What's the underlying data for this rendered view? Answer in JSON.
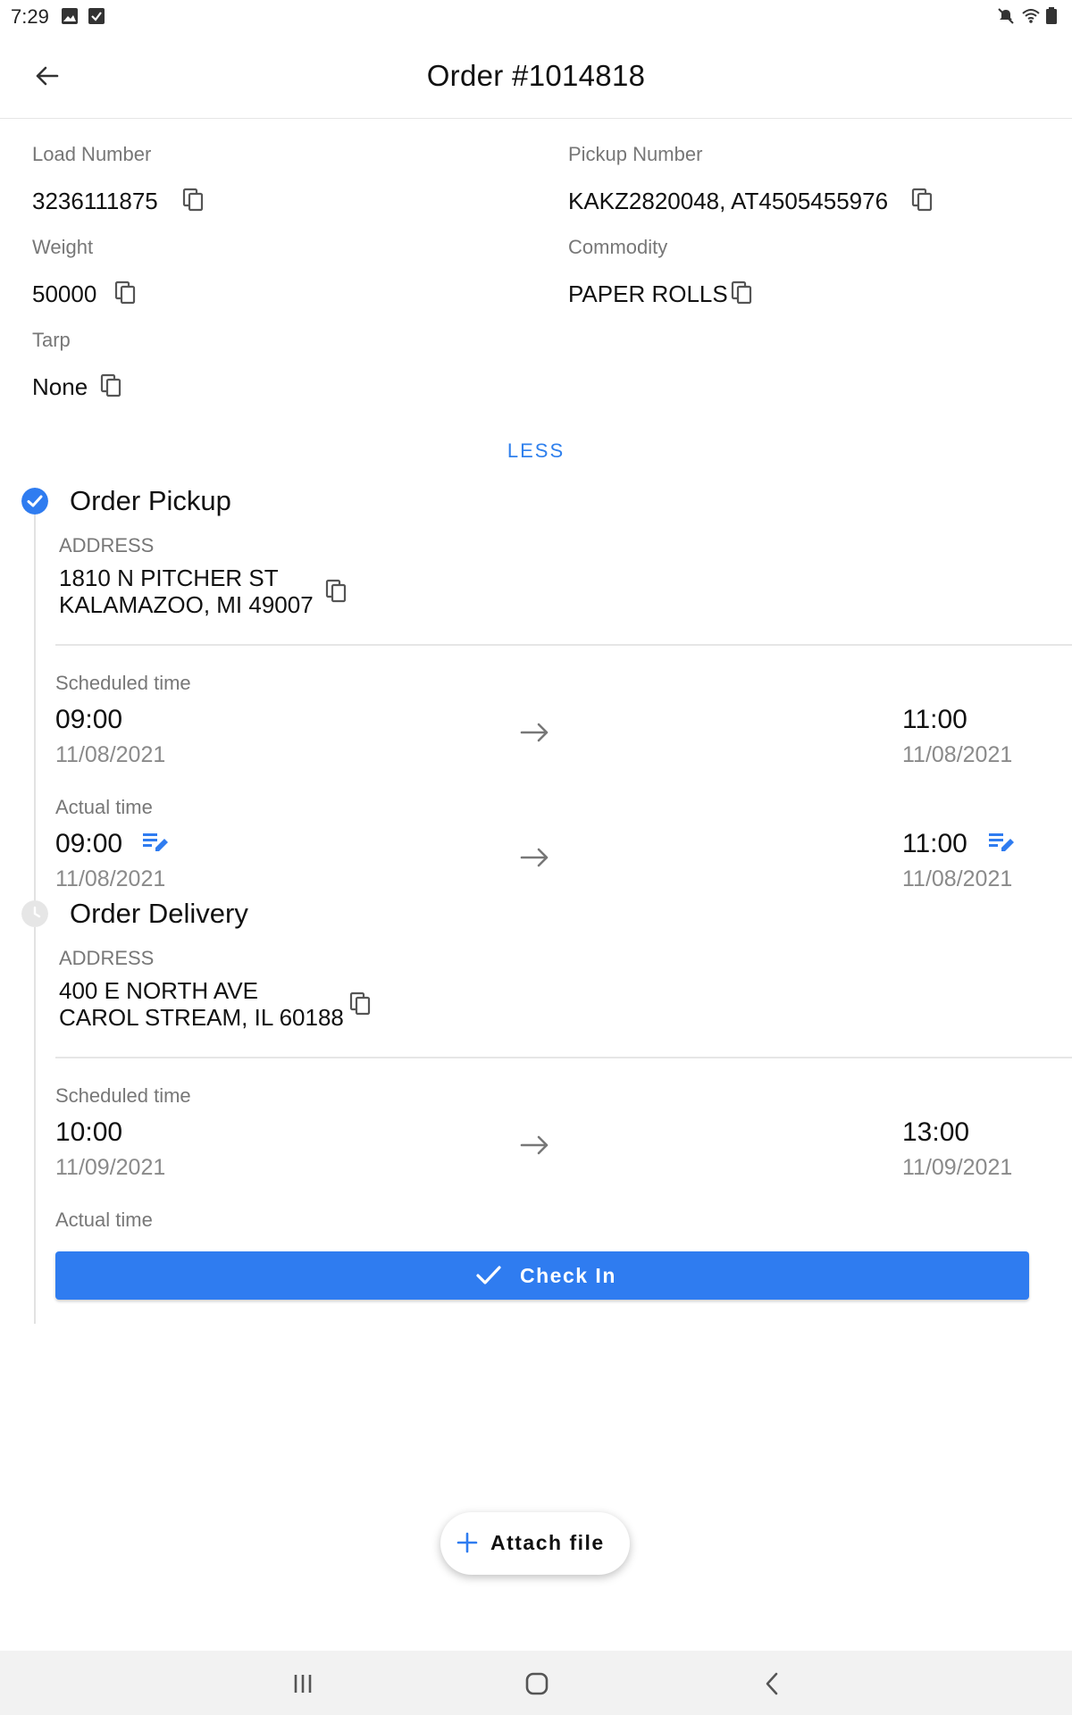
{
  "status_bar": {
    "time": "7:29",
    "left_icons": [
      "image-icon",
      "checkbox-icon"
    ],
    "right_icons": [
      "mute-icon",
      "wifi-icon",
      "battery-icon"
    ]
  },
  "app_bar": {
    "title": "Order #1014818",
    "back_icon": "arrow-left-icon"
  },
  "details": {
    "load_number": {
      "label": "Load Number",
      "value": "3236111875"
    },
    "pickup_number": {
      "label": "Pickup Number",
      "value": "KAKZ2820048, AT4505455976"
    },
    "weight": {
      "label": "Weight",
      "value": "50000"
    },
    "commodity": {
      "label": "Commodity",
      "value": "PAPER ROLLS"
    },
    "tarp": {
      "label": "Tarp",
      "value": "None"
    },
    "copy_icon": "copy-icon"
  },
  "toggle_label": "LESS",
  "steps": [
    {
      "title": "Order Pickup",
      "status": "completed",
      "address_label": "ADDRESS",
      "address_line1": "1810 N PITCHER ST",
      "address_line2": "KALAMAZOO, MI 49007",
      "scheduled_label": "Scheduled time",
      "scheduled_start_time": "09:00",
      "scheduled_start_date": "11/08/2021",
      "scheduled_end_time": "11:00",
      "scheduled_end_date": "11/08/2021",
      "actual_label": "Actual time",
      "actual_start_time": "09:00",
      "actual_start_date": "11/08/2021",
      "actual_end_time": "11:00",
      "actual_end_date": "11/08/2021"
    },
    {
      "title": "Order Delivery",
      "status": "pending",
      "address_label": "ADDRESS",
      "address_line1": "400 E NORTH AVE",
      "address_line2": "CAROL STREAM, IL 60188",
      "scheduled_label": "Scheduled time",
      "scheduled_start_time": "10:00",
      "scheduled_start_date": "11/09/2021",
      "scheduled_end_time": "13:00",
      "scheduled_end_date": "11/09/2021",
      "actual_label": "Actual time"
    }
  ],
  "check_in_label": "Check In",
  "attach_file_label": "Attach file",
  "colors": {
    "accent": "#2f7cf0",
    "link": "#2f80ed",
    "muted": "#777777",
    "pending_icon": "#e6e6e6"
  },
  "nav_bar_icons": [
    "recent-apps-icon",
    "home-icon",
    "back-icon"
  ]
}
